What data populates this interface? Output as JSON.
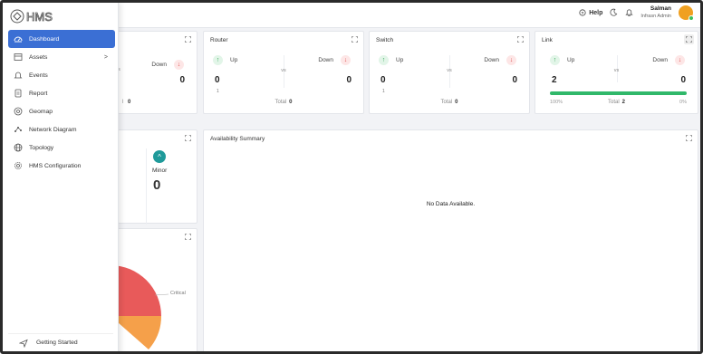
{
  "brand": {
    "logo_text": "HMS"
  },
  "header": {
    "help_label": "Help",
    "user_name": "Salman",
    "user_role": "Infrasn Admin"
  },
  "sidebar": {
    "items": [
      {
        "label": "Dashboard",
        "icon": "dashboard-icon",
        "active": true
      },
      {
        "label": "Assets",
        "icon": "assets-icon",
        "chevron": ">"
      },
      {
        "label": "Events",
        "icon": "bell-icon"
      },
      {
        "label": "Report",
        "icon": "report-icon"
      },
      {
        "label": "Geomap",
        "icon": "map-pin-icon"
      },
      {
        "label": "Network Diagram",
        "icon": "network-icon"
      },
      {
        "label": "Topology",
        "icon": "globe-icon"
      },
      {
        "label": "HMS Configuration",
        "icon": "gear-icon"
      }
    ],
    "footer_label": "Getting Started"
  },
  "cards": {
    "first": {
      "down_fragment": "Down",
      "down_value": "0",
      "vs_fragment": "s",
      "total_fragment": "l",
      "total_value": "0"
    },
    "router": {
      "title": "Router",
      "up_label": "Up",
      "down_label": "Down",
      "vs": "vs",
      "up_value": "0",
      "down_value": "0",
      "tick": "1",
      "total_label": "Total",
      "total_value": "0"
    },
    "switch": {
      "title": "Switch",
      "up_label": "Up",
      "down_label": "Down",
      "vs": "vs",
      "up_value": "0",
      "down_value": "0",
      "tick": "1",
      "total_label": "Total",
      "total_value": "0"
    },
    "link": {
      "title": "Link",
      "up_label": "Up",
      "down_label": "Down",
      "vs": "vs",
      "up_value": "2",
      "down_value": "0",
      "total_label": "Total",
      "total_value": "2",
      "pct_left": "100%",
      "pct_right": "0%",
      "up_fraction": 1.0
    },
    "availability": {
      "title": "Availability Summary",
      "empty_text": "No Data Available."
    },
    "severity": {
      "minor_label": "Minor",
      "minor_value": "0"
    },
    "pie": {
      "slice_label": "Critical",
      "colors": {
        "critical": "#e85a5a",
        "other": "#f5a04a"
      }
    }
  },
  "colors": {
    "accent": "#3b6fd4",
    "up": "#3aab5c",
    "down": "#e05454",
    "bar": "#30b86a",
    "minor": "#1f9a9a"
  }
}
